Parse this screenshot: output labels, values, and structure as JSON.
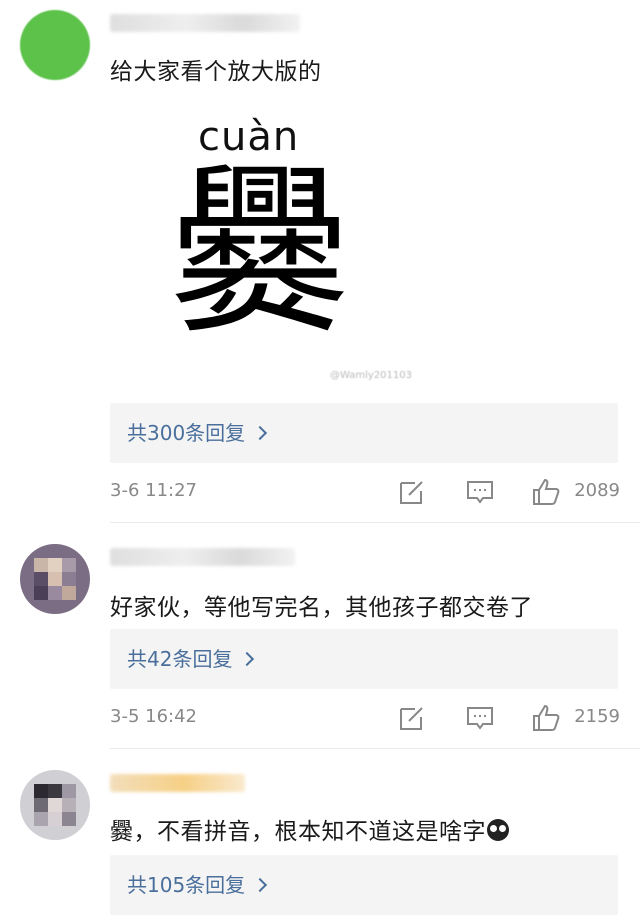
{
  "comments": [
    {
      "text": "给大家看个放大版的",
      "attachment": {
        "pinyin": "cuàn",
        "character": "爨",
        "watermark": "@Wamly201103"
      },
      "reply_label": "共300条回复",
      "time": "3-6 11:27",
      "likes": "2089"
    },
    {
      "text": "好家伙，等他写完名，其他孩子都交卷了",
      "reply_label": "共42条回复",
      "time": "3-5 16:42",
      "likes": "2159"
    },
    {
      "text": "爨，不看拼音，根本知不道这是啥字",
      "reply_label": "共105条回复"
    }
  ],
  "icons": {
    "edit": "edit-icon",
    "comment": "comment-icon",
    "like": "thumbs-up-icon",
    "reply_chevron": "chevron-right-icon"
  },
  "colors": {
    "reply_link": "#4a6f9c",
    "meta_text": "#888888",
    "reply_bg": "#f4f4f4"
  }
}
